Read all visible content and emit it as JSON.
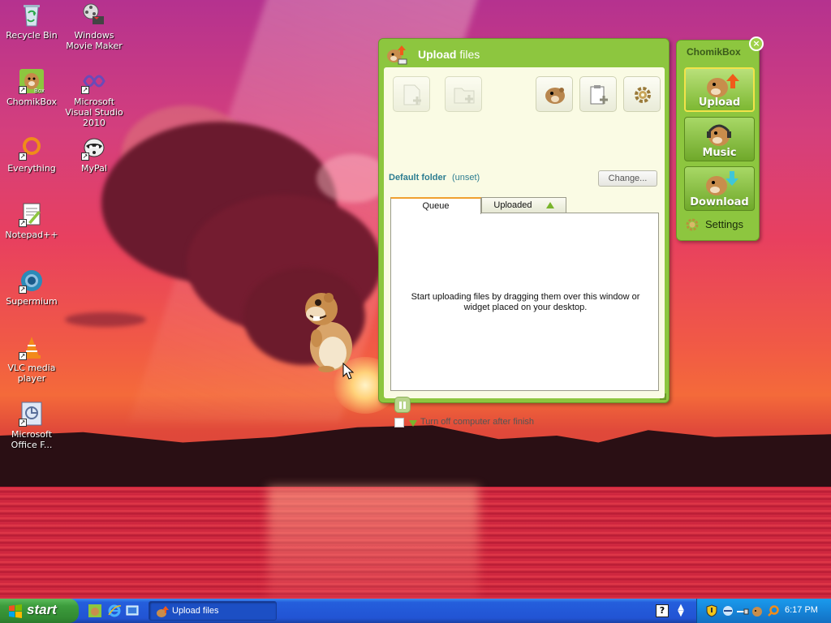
{
  "desktop": {
    "icons": [
      {
        "label": "Recycle Bin",
        "icon": "recycle-bin-icon"
      },
      {
        "label": "Windows Movie Maker",
        "icon": "movie-maker-icon"
      },
      {
        "label": "ChomikBox",
        "icon": "chomikbox-icon"
      },
      {
        "label": "Microsoft Visual Studio 2010",
        "icon": "visual-studio-icon"
      },
      {
        "label": "Everything",
        "icon": "everything-search-icon"
      },
      {
        "label": "MyPal",
        "icon": "mypal-browser-icon"
      },
      {
        "label": "Notepad++",
        "icon": "notepadpp-icon"
      },
      {
        "label": "Supermium",
        "icon": "supermium-browser-icon"
      },
      {
        "label": "VLC media player",
        "icon": "vlc-icon"
      },
      {
        "label": "Microsoft Office F...",
        "icon": "office-file-icon"
      }
    ]
  },
  "upload_window": {
    "title_bold": "Upload",
    "title_rest": "files",
    "toolbar": {
      "buttons": [
        "add-file-icon",
        "add-folder-icon",
        "hamster-icon",
        "clipboard-add-icon",
        "gear-icon"
      ]
    },
    "default_folder_label": "Default folder",
    "default_folder_value": "(unset)",
    "change_label": "Change...",
    "tabs": [
      {
        "label": "Queue",
        "active": true
      },
      {
        "label": "Uploaded",
        "active": false
      }
    ],
    "empty_message": "Start uploading files by dragging them over this window or widget placed on your desktop.",
    "turn_off_label": "Turn off computer after finish"
  },
  "chomikbox_widget": {
    "title": "ChomikBox",
    "buttons": [
      {
        "label": "Upload",
        "active": true
      },
      {
        "label": "Music",
        "active": false
      },
      {
        "label": "Download",
        "active": false
      }
    ],
    "settings_label": "Settings"
  },
  "taskbar": {
    "start_label": "start",
    "task_item": "Upload files",
    "help_label": "?",
    "clock": "6:17 PM"
  },
  "colors": {
    "accent_green": "#8dc63f",
    "taskbar_blue": "#245edc",
    "start_green": "#3c9c3c",
    "link_teal": "#2d7d91"
  }
}
